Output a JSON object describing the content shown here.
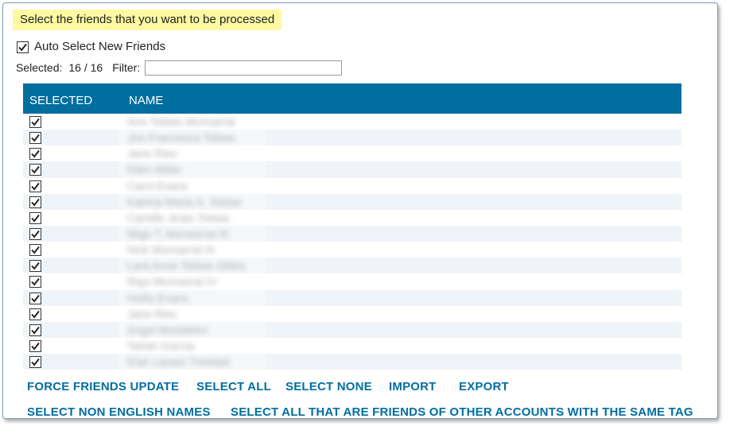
{
  "instruction": "Select the friends that you want to be processed",
  "auto_select": {
    "label": "Auto Select New Friends",
    "checked": true
  },
  "selection": {
    "label": "Selected:",
    "count": "16 / 16",
    "filter_label": "Filter:",
    "filter_value": ""
  },
  "grid": {
    "columns": [
      "SELECTED",
      "NAME"
    ],
    "rows": [
      {
        "selected": true,
        "name": "Ann Tobias Monsarrat"
      },
      {
        "selected": true,
        "name": "Jon Francesca Tobias"
      },
      {
        "selected": true,
        "name": "Jane Ries"
      },
      {
        "selected": true,
        "name": "Ellen Miller"
      },
      {
        "selected": true,
        "name": "Carol Evans"
      },
      {
        "selected": true,
        "name": "Katrina Marie A. Tobias"
      },
      {
        "selected": true,
        "name": "Camille Jirato Tobias"
      },
      {
        "selected": true,
        "name": "Migo T. Monsarrat III"
      },
      {
        "selected": true,
        "name": "Nick Monsarrat III"
      },
      {
        "selected": true,
        "name": "Lara Anne Tobias Gibbs"
      },
      {
        "selected": true,
        "name": "Rigo Monsarrat IV"
      },
      {
        "selected": true,
        "name": "Hollis Evans"
      },
      {
        "selected": true,
        "name": "Jane Ries"
      },
      {
        "selected": true,
        "name": "Angel Mondeleri"
      },
      {
        "selected": true,
        "name": "Tartan Garcia"
      },
      {
        "selected": true,
        "name": "Elan Lazaro Trinidad"
      }
    ]
  },
  "actions": {
    "force_update": "FORCE FRIENDS UPDATE",
    "select_all": "SELECT ALL",
    "select_none": "SELECT NONE",
    "import": "IMPORT",
    "export": "EXPORT",
    "select_non_english": "SELECT NON ENGLISH NAMES",
    "select_same_tag": "SELECT ALL THAT ARE FRIENDS OF OTHER ACCOUNTS WITH THE SAME TAG"
  },
  "colors": {
    "accent": "#006e9f",
    "highlight": "#fdf9a2",
    "row_alt": "#eef4f8"
  }
}
